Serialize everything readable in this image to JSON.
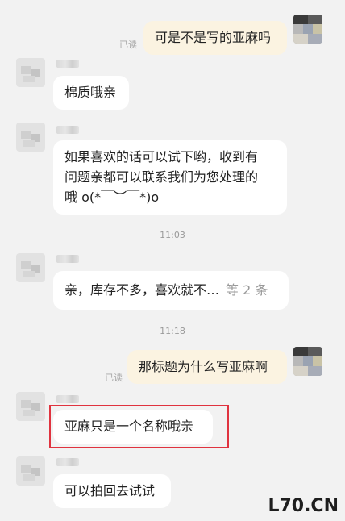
{
  "chat": {
    "read_label": "已读",
    "messages": [
      {
        "text": "可是不是写的亚麻吗"
      },
      {
        "text": "棉质哦亲"
      },
      {
        "line1": "如果喜欢的话可以试下哟，收到有",
        "line2": "问题亲都可以联系我们为您处理的",
        "line3": "哦 o(*￣︶￣*)o"
      },
      {
        "text": "亲，库存不多，喜欢就不…",
        "more": "等 2 条"
      },
      {
        "text": "那标题为什么写亚麻啊"
      },
      {
        "text": "亚麻只是一个名称哦亲"
      },
      {
        "text": "可以拍回去试试"
      }
    ],
    "times": [
      "11:03",
      "11:18"
    ]
  },
  "watermark": "L70.CN"
}
